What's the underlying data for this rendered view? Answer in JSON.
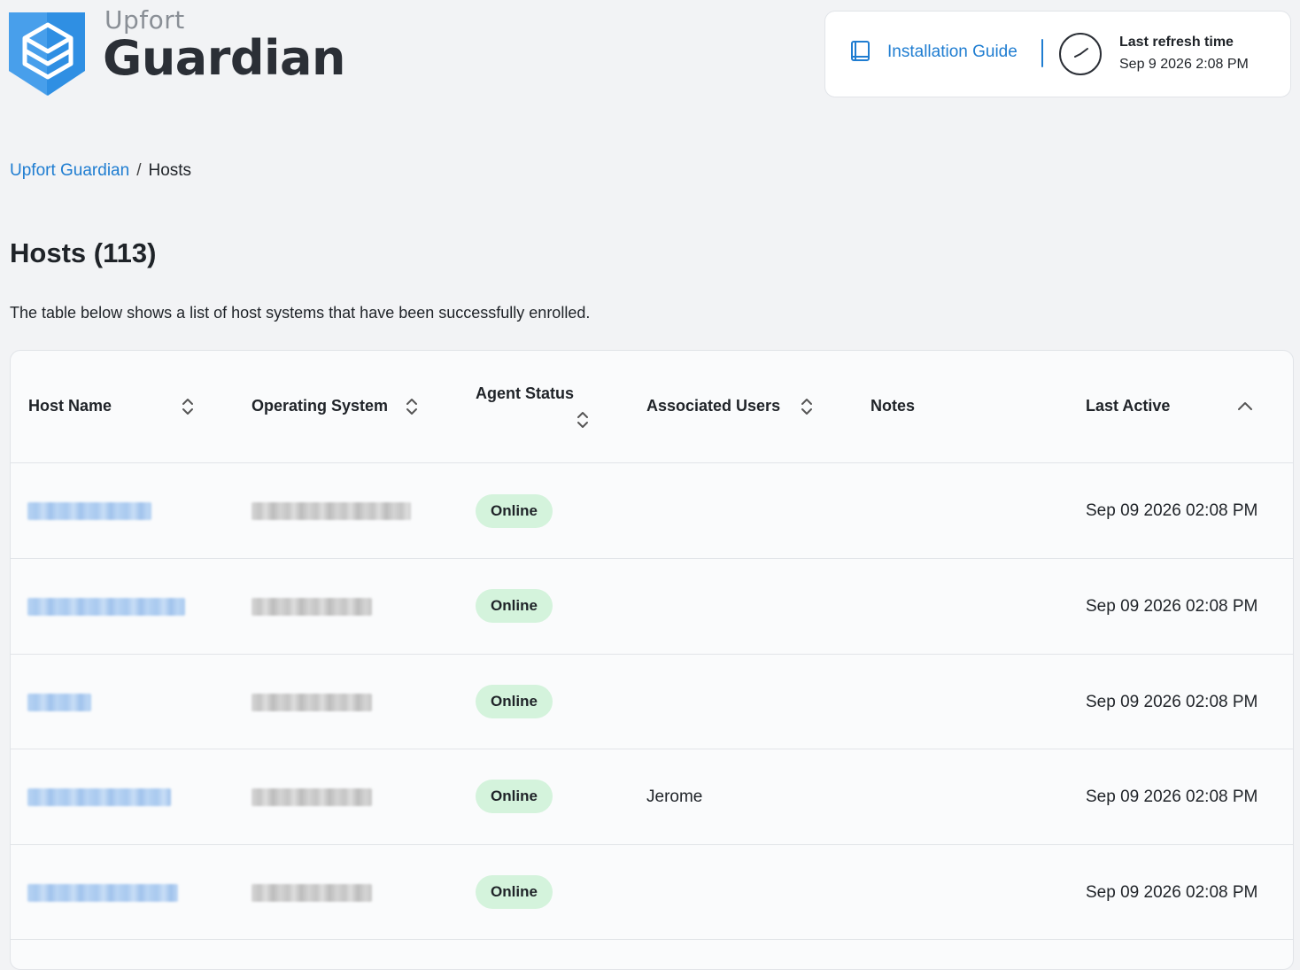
{
  "brand": {
    "top": "Upfort",
    "main": "Guardian"
  },
  "header": {
    "guide_label": "Installation Guide",
    "refresh_label": "Last refresh time",
    "refresh_time": "Sep 9 2026 2:08 PM",
    "accent_color": "#1f7dd1"
  },
  "breadcrumb": {
    "root": "Upfort Guardian",
    "separator": "/",
    "current": "Hosts"
  },
  "page": {
    "title": "Hosts (113)",
    "description": "The table below shows a list of host systems that have been successfully enrolled."
  },
  "table": {
    "columns": [
      {
        "label": "Host Name",
        "sort": "none"
      },
      {
        "label": "Operating System",
        "sort": "none"
      },
      {
        "label": "Agent Status",
        "sort": "none"
      },
      {
        "label": "Associated Users",
        "sort": "none"
      },
      {
        "label": "Notes",
        "sort": null
      },
      {
        "label": "Last Active",
        "sort": "ascending"
      }
    ],
    "rows": [
      {
        "host": "[redacted]",
        "os": "[redacted]",
        "status": "Online",
        "users": "",
        "notes": "",
        "last_active": "Sep 09 2026 02:08 PM"
      },
      {
        "host": "[redacted]",
        "os": "[redacted]",
        "status": "Online",
        "users": "",
        "notes": "",
        "last_active": "Sep 09 2026 02:08 PM"
      },
      {
        "host": "[redacted]",
        "os": "[redacted]",
        "status": "Online",
        "users": "",
        "notes": "",
        "last_active": "Sep 09 2026 02:08 PM"
      },
      {
        "host": "[redacted]",
        "os": "[redacted]",
        "status": "Online",
        "users": "Jerome",
        "notes": "",
        "last_active": "Sep 09 2026 02:08 PM"
      },
      {
        "host": "[redacted]",
        "os": "[redacted]",
        "status": "Online",
        "users": "",
        "notes": "",
        "last_active": "Sep 09 2026 02:08 PM"
      }
    ],
    "status_color": "#d4f3dc"
  }
}
